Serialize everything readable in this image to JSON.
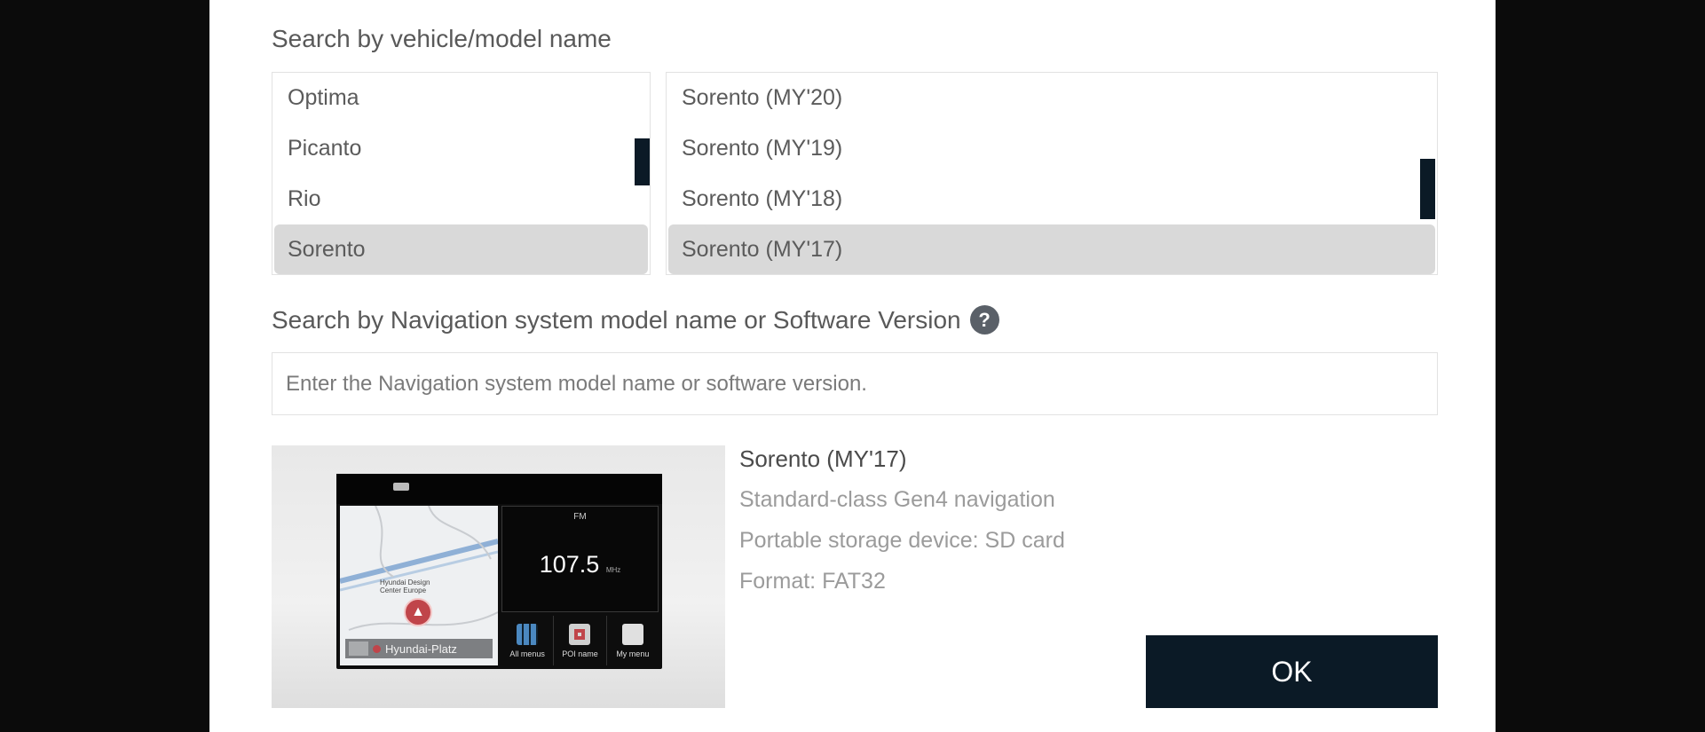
{
  "vehicle_search": {
    "label": "Search by vehicle/model name",
    "models": [
      "Optima",
      "Picanto",
      "Rio",
      "Sorento"
    ],
    "selected_model": "Sorento",
    "model_years": [
      "Sorento (MY'20)",
      "Sorento (MY'19)",
      "Sorento (MY'18)",
      "Sorento (MY'17)"
    ],
    "selected_year": "Sorento (MY'17)"
  },
  "nav_search": {
    "label": "Search by Navigation system model name or Software Version",
    "help_icon": "?",
    "placeholder": "Enter the Navigation system model name or software version."
  },
  "preview": {
    "radio_band": "FM",
    "frequency": "107.5",
    "frequency_unit": "MHz",
    "poi": "Hyundai Design Center Europe",
    "street": "Hyundai-Platz",
    "shortcuts": [
      "All menus",
      "POI name",
      "My menu"
    ]
  },
  "info": {
    "title": "Sorento (MY'17)",
    "nav_class": "Standard-class Gen4 navigation",
    "storage": "Portable storage device: SD card",
    "format": "Format: FAT32"
  },
  "ok_label": "OK",
  "colors": {
    "primary_button": "#0b1a26",
    "selected_row": "#d9d9d9",
    "backdrop": "#0b0b0b"
  }
}
